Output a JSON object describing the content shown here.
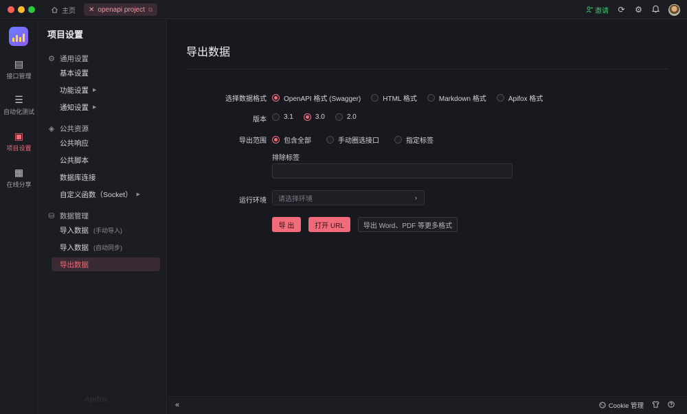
{
  "titlebar": {
    "home_tab": "主页",
    "project_tab": "openapi project",
    "invite": "邀请"
  },
  "rail": {
    "items": [
      {
        "label": "接口管理"
      },
      {
        "label": "自动化测试"
      },
      {
        "label": "项目设置"
      },
      {
        "label": "在线分享"
      }
    ]
  },
  "sidebar": {
    "title": "项目设置",
    "groups": [
      {
        "label": "通用设置",
        "items": [
          {
            "label": "基本设置",
            "hint": ""
          },
          {
            "label": "功能设置",
            "hint": ""
          },
          {
            "label": "通知设置",
            "hint": ""
          }
        ]
      },
      {
        "label": "公共资源",
        "items": [
          {
            "label": "公共响应",
            "hint": ""
          },
          {
            "label": "公共脚本",
            "hint": ""
          },
          {
            "label": "数据库连接",
            "hint": ""
          },
          {
            "label": "自定义函数（Socket）",
            "hint": ""
          }
        ]
      },
      {
        "label": "数据管理",
        "items": [
          {
            "label": "导入数据",
            "hint": "(手动导入)"
          },
          {
            "label": "导入数据",
            "hint": "(自动同步)"
          },
          {
            "label": "导出数据",
            "hint": ""
          }
        ]
      }
    ],
    "watermark": "Apifox"
  },
  "main": {
    "title": "导出数据",
    "format": {
      "label": "选择数据格式",
      "options": [
        "OpenAPI 格式 (Swagger)",
        "HTML 格式",
        "Markdown 格式",
        "Apifox 格式"
      ],
      "selected": "OpenAPI 格式 (Swagger)"
    },
    "version": {
      "label": "版本",
      "options": [
        "3.1",
        "3.0",
        "2.0"
      ],
      "selected": "3.0"
    },
    "scope": {
      "label": "导出范围",
      "options": [
        "包含全部",
        "手动圈选接口",
        "指定标签"
      ],
      "selected": "包含全部"
    },
    "exclude_tags": {
      "label": "排除标签",
      "value": ""
    },
    "environment": {
      "label": "运行环境",
      "placeholder": "请选择环境"
    },
    "buttons": {
      "export": "导 出",
      "open_url": "打开 URL",
      "more": "导出 Word、PDF 等更多格式"
    }
  },
  "bottombar": {
    "cookie": "Cookie 管理"
  },
  "colors": {
    "accent": "#f26b7a",
    "invite": "#3fbf6d",
    "background": "#18181f",
    "panel": "#1c1c23"
  }
}
